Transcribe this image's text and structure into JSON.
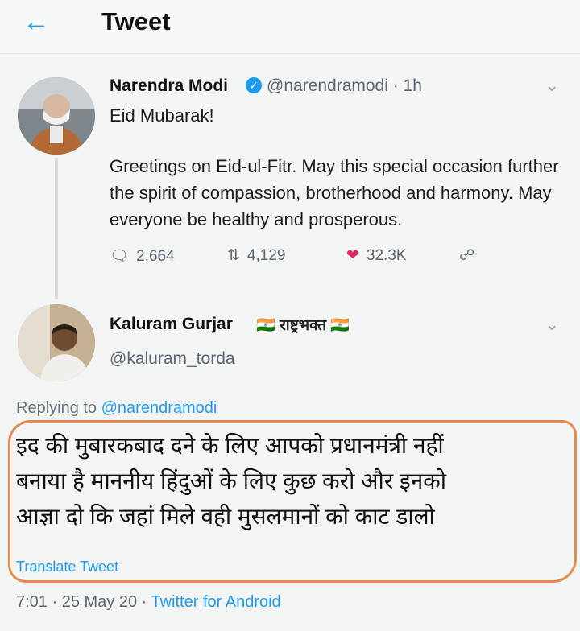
{
  "header": {
    "back_icon": "arrow-left-icon",
    "title": "Tweet"
  },
  "original_tweet": {
    "name": "Narendra Modi",
    "verified_icon": "verified-check-icon",
    "handle_time": "@narendramodi · 1h",
    "line1": "Eid Mubarak!",
    "body": "Greetings on Eid-ul-Fitr. May this special occasion further the spirit of compassion, brotherhood and harmony. May everyone be healthy and prosperous.",
    "replies": "2,664",
    "retweets": "4,129",
    "likes": "32.3K"
  },
  "reply_tweet": {
    "name": "Kaluram Gurjar",
    "badge": "राष्ट्रभक्त",
    "handle": "@kaluram_torda",
    "replying_prefix": "Replying to",
    "replying_handle": "@narendramodi",
    "body_line1": "इद की मुबारकबाद दने के लिए आपको प्रधानमंत्री नहीं",
    "body_line2": "बनाया है माननीय हिंदुओं के लिए कुछ करो और इनको",
    "body_line3": "आज्ञा दो कि जहां मिले वही मुसलमानों को काट डालो",
    "translate_label": "Translate Tweet",
    "timestamp": "7:01 · 25 May 20 · ",
    "source": "Twitter for Android"
  },
  "colors": {
    "accent": "#1d9bf0",
    "like": "#e0245e",
    "annotation": "#e58a4a"
  }
}
